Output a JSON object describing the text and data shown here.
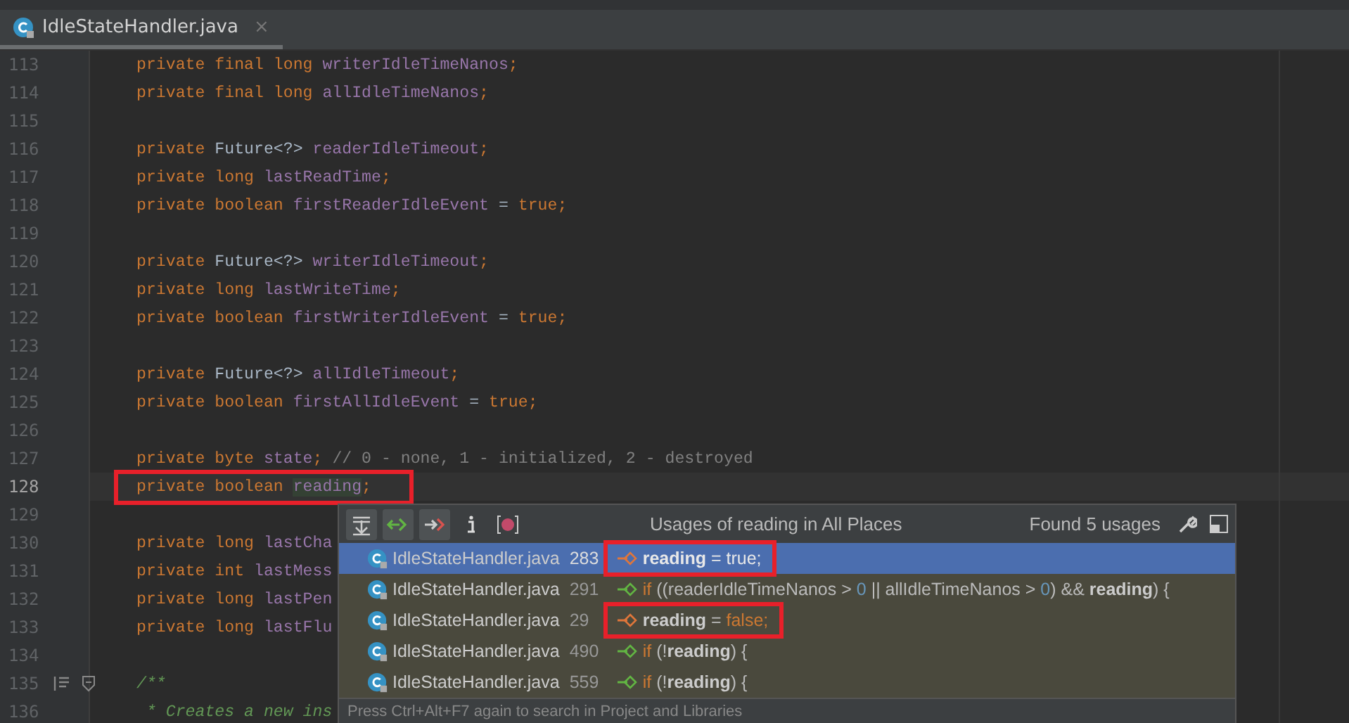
{
  "tab": {
    "label": "IdleStateHandler.java",
    "close": "×",
    "selected": true
  },
  "code_lines": [
    {
      "number": "113",
      "tokens": [
        {
          "text": "private ",
          "kind": "kw"
        },
        {
          "text": "final ",
          "kind": "kw"
        },
        {
          "text": "long ",
          "kind": "kw"
        },
        {
          "text": "writerIdleTimeNanos",
          "kind": "field"
        },
        {
          "text": ";",
          "kind": "kw"
        }
      ]
    },
    {
      "number": "114",
      "tokens": [
        {
          "text": "private ",
          "kind": "kw"
        },
        {
          "text": "final ",
          "kind": "kw"
        },
        {
          "text": "long ",
          "kind": "kw"
        },
        {
          "text": "allIdleTimeNanos",
          "kind": "field"
        },
        {
          "text": ";",
          "kind": "kw"
        }
      ]
    },
    {
      "number": "115"
    },
    {
      "number": "116",
      "tokens": [
        {
          "text": "private ",
          "kind": "kw"
        },
        {
          "text": "Future<?> ",
          "kind": "type"
        },
        {
          "text": "readerIdleTimeout",
          "kind": "field"
        },
        {
          "text": ";",
          "kind": "kw"
        }
      ]
    },
    {
      "number": "117",
      "tokens": [
        {
          "text": "private ",
          "kind": "kw"
        },
        {
          "text": "long ",
          "kind": "kw"
        },
        {
          "text": "lastReadTime",
          "kind": "field"
        },
        {
          "text": ";",
          "kind": "kw"
        }
      ]
    },
    {
      "number": "118",
      "tokens": [
        {
          "text": "private ",
          "kind": "kw"
        },
        {
          "text": "boolean ",
          "kind": "kw"
        },
        {
          "text": "firstReaderIdleEvent",
          "kind": "field"
        },
        {
          "text": " = ",
          "kind": "type"
        },
        {
          "text": "true",
          "kind": "kw"
        },
        {
          "text": ";",
          "kind": "kw"
        }
      ]
    },
    {
      "number": "119"
    },
    {
      "number": "120",
      "tokens": [
        {
          "text": "private ",
          "kind": "kw"
        },
        {
          "text": "Future<?> ",
          "kind": "type"
        },
        {
          "text": "writerIdleTimeout",
          "kind": "field"
        },
        {
          "text": ";",
          "kind": "kw"
        }
      ]
    },
    {
      "number": "121",
      "tokens": [
        {
          "text": "private ",
          "kind": "kw"
        },
        {
          "text": "long ",
          "kind": "kw"
        },
        {
          "text": "lastWriteTime",
          "kind": "field"
        },
        {
          "text": ";",
          "kind": "kw"
        }
      ]
    },
    {
      "number": "122",
      "tokens": [
        {
          "text": "private ",
          "kind": "kw"
        },
        {
          "text": "boolean ",
          "kind": "kw"
        },
        {
          "text": "firstWriterIdleEvent",
          "kind": "field"
        },
        {
          "text": " = ",
          "kind": "type"
        },
        {
          "text": "true",
          "kind": "kw"
        },
        {
          "text": ";",
          "kind": "kw"
        }
      ]
    },
    {
      "number": "123"
    },
    {
      "number": "124",
      "tokens": [
        {
          "text": "private ",
          "kind": "kw"
        },
        {
          "text": "Future<?> ",
          "kind": "type"
        },
        {
          "text": "allIdleTimeout",
          "kind": "field"
        },
        {
          "text": ";",
          "kind": "kw"
        }
      ]
    },
    {
      "number": "125",
      "tokens": [
        {
          "text": "private ",
          "kind": "kw"
        },
        {
          "text": "boolean ",
          "kind": "kw"
        },
        {
          "text": "firstAllIdleEvent",
          "kind": "field"
        },
        {
          "text": " = ",
          "kind": "type"
        },
        {
          "text": "true",
          "kind": "kw"
        },
        {
          "text": ";",
          "kind": "kw"
        }
      ]
    },
    {
      "number": "126"
    },
    {
      "number": "127",
      "tokens": [
        {
          "text": "private ",
          "kind": "kw"
        },
        {
          "text": "byte ",
          "kind": "kw"
        },
        {
          "text": "state",
          "kind": "field"
        },
        {
          "text": "; ",
          "kind": "kw"
        },
        {
          "text": "// 0 - none, 1 - initialized, 2 - destroyed",
          "kind": "comment"
        }
      ]
    },
    {
      "number": "128",
      "current": true,
      "marked": true,
      "tokens": [
        {
          "text": "private ",
          "kind": "kw"
        },
        {
          "text": "boolean ",
          "kind": "kw"
        },
        {
          "text": "reading",
          "kind": "hl"
        },
        {
          "text": ";",
          "kind": "kw"
        }
      ]
    },
    {
      "number": "129"
    },
    {
      "number": "130",
      "tokens": [
        {
          "text": "private ",
          "kind": "kw"
        },
        {
          "text": "long ",
          "kind": "kw"
        },
        {
          "text": "lastCha",
          "kind": "field"
        }
      ]
    },
    {
      "number": "131",
      "tokens": [
        {
          "text": "private ",
          "kind": "kw"
        },
        {
          "text": "int ",
          "kind": "kw"
        },
        {
          "text": "lastMess",
          "kind": "field"
        }
      ]
    },
    {
      "number": "132",
      "tokens": [
        {
          "text": "private ",
          "kind": "kw"
        },
        {
          "text": "long ",
          "kind": "kw"
        },
        {
          "text": "lastPen",
          "kind": "field"
        }
      ]
    },
    {
      "number": "133",
      "tokens": [
        {
          "text": "private ",
          "kind": "kw"
        },
        {
          "text": "long ",
          "kind": "kw"
        },
        {
          "text": "lastFlu",
          "kind": "field"
        }
      ]
    },
    {
      "number": "134"
    },
    {
      "number": "135",
      "fold": true,
      "tokens": [
        {
          "text": "/**",
          "kind": "doc"
        }
      ]
    },
    {
      "number": "136",
      "tokens": [
        {
          "text": " * Creates a new ins",
          "kind": "doc"
        }
      ]
    }
  ],
  "usages_popup": {
    "title": "Usages of reading in All Places",
    "found": "Found 5 usages",
    "hint": "Press Ctrl+Alt+F7 again to search in Project and Libraries",
    "rows": [
      {
        "file": "IdleStateHandler.java",
        "line": "283",
        "kind": "write",
        "selected": true,
        "marked": true,
        "code": [
          {
            "text": "reading",
            "kind": "bold"
          },
          {
            "text": " = true;",
            "kind": "plain"
          }
        ]
      },
      {
        "file": "IdleStateHandler.java",
        "line": "291",
        "kind": "read",
        "selected": false,
        "marked": false,
        "code": [
          {
            "text": "if ",
            "kind": "kw"
          },
          {
            "text": "((readerIdleTimeNanos > ",
            "kind": "plain"
          },
          {
            "text": "0",
            "kind": "num"
          },
          {
            "text": " || allIdleTimeNanos > ",
            "kind": "plain"
          },
          {
            "text": "0",
            "kind": "num"
          },
          {
            "text": ") && ",
            "kind": "plain"
          },
          {
            "text": "reading",
            "kind": "bold"
          },
          {
            "text": ") {",
            "kind": "plain"
          }
        ]
      },
      {
        "file": "IdleStateHandler.java",
        "line": "29",
        "kind": "write",
        "selected": false,
        "marked": true,
        "code": [
          {
            "text": "reading",
            "kind": "bold"
          },
          {
            "text": " = ",
            "kind": "plain"
          },
          {
            "text": "false;",
            "kind": "kw"
          }
        ]
      },
      {
        "file": "IdleStateHandler.java",
        "line": "490",
        "kind": "read",
        "selected": false,
        "marked": false,
        "code": [
          {
            "text": "if ",
            "kind": "kw"
          },
          {
            "text": "(!",
            "kind": "plain"
          },
          {
            "text": "reading",
            "kind": "bold"
          },
          {
            "text": ") {",
            "kind": "plain"
          }
        ]
      },
      {
        "file": "IdleStateHandler.java",
        "line": "559",
        "kind": "read",
        "selected": false,
        "marked": false,
        "code": [
          {
            "text": "if ",
            "kind": "kw"
          },
          {
            "text": "(!",
            "kind": "plain"
          },
          {
            "text": "reading",
            "kind": "bold"
          },
          {
            "text": ") {",
            "kind": "plain"
          }
        ]
      }
    ]
  }
}
